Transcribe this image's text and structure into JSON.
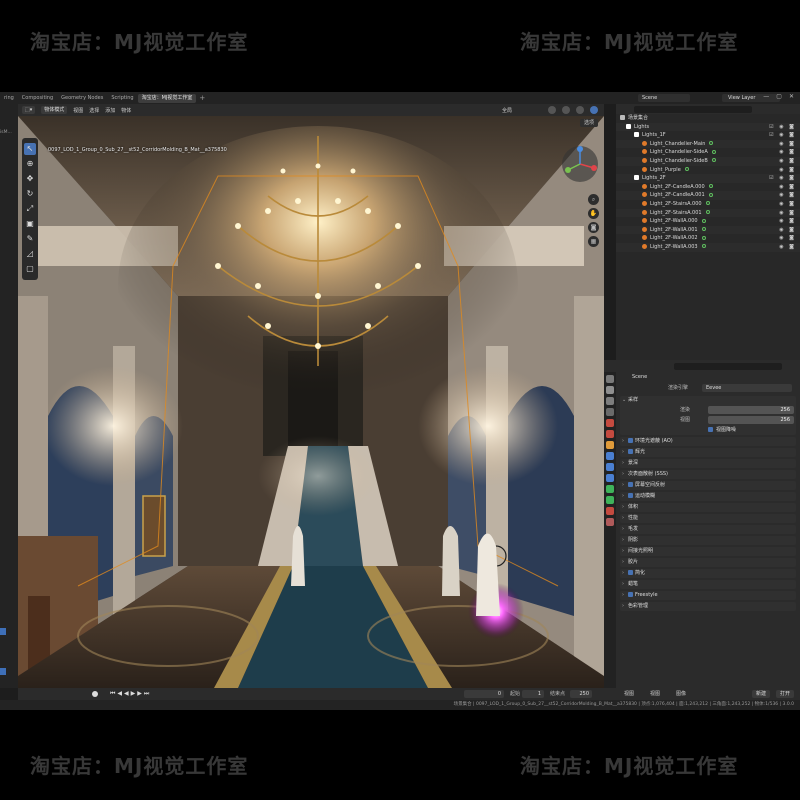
{
  "watermark": "淘宝店：MJ视觉工作室",
  "topbar": {
    "tabs": [
      "ring",
      "Compositing",
      "Geometry Nodes",
      "Scripting",
      "淘宝店：MJ视觉工作室"
    ],
    "plus": "+",
    "scene": "Scene",
    "view_layer": "View Layer"
  },
  "left_strip_label": "isM...",
  "viewport": {
    "mode": "物体模式",
    "menus": [
      "视图",
      "选择",
      "添加",
      "物体"
    ],
    "transform": "全局",
    "options": "选项",
    "object_info": "0097_LOD_1_Group_0_Sub_27__st52_CorridorMolding_B_Mat__a375830"
  },
  "timeline": {
    "current": "0",
    "start_label": "起始",
    "start": "1",
    "end_label": "结束点",
    "end": "250"
  },
  "status_bar": "场景集合 | 0097_LOD_1_Group_0_Sub_27__st52_CorridorMolding_B_Mat__a375830 | 顶点:1,076,404 | 面:1,243,212 | 三角面:1,243,252 | 物体:1/536 | 3.0.0",
  "outliner": {
    "rows": [
      {
        "name": "场景集合",
        "type": "scene",
        "indent": 4
      },
      {
        "name": "Lights",
        "type": "coll",
        "indent": 10
      },
      {
        "name": "Lights_1F",
        "type": "coll",
        "indent": 18
      },
      {
        "name": "Light_Chandelier-Main",
        "type": "light",
        "indent": 26
      },
      {
        "name": "Light_Chandelier-SideA",
        "type": "light",
        "indent": 26
      },
      {
        "name": "Light_Chandelier-SideB",
        "type": "light",
        "indent": 26
      },
      {
        "name": "Light_Purple",
        "type": "light",
        "indent": 26
      },
      {
        "name": "Lights_2F",
        "type": "coll",
        "indent": 18
      },
      {
        "name": "Light_2F-CandleA.000",
        "type": "light",
        "indent": 26
      },
      {
        "name": "Light_2F-CandleA.001",
        "type": "light",
        "indent": 26
      },
      {
        "name": "Light_2F-StairsA.000",
        "type": "light",
        "indent": 26
      },
      {
        "name": "Light_2F-StairsA.001",
        "type": "light",
        "indent": 26
      },
      {
        "name": "Light_2F-WallA.000",
        "type": "light",
        "indent": 26
      },
      {
        "name": "Light_2F-WallA.001",
        "type": "light",
        "indent": 26
      },
      {
        "name": "Light_2F-WallA.002",
        "type": "light",
        "indent": 26
      },
      {
        "name": "Light_2F-WallA.003",
        "type": "light",
        "indent": 26
      }
    ]
  },
  "properties": {
    "scene_name": "Scene",
    "engine_label": "渲染引擎",
    "engine": "Eevee",
    "sampling": {
      "title": "采样",
      "render_label": "渲染",
      "render": "256",
      "viewport_label": "视图",
      "viewport": "256",
      "denoise_label": "视图降噪"
    },
    "panels": [
      {
        "label": "环境光遮蔽 (AO)",
        "checkbox": true
      },
      {
        "label": "辉光",
        "checkbox": true
      },
      {
        "label": "景深",
        "checkbox": false
      },
      {
        "label": "次表面散射 (SSS)",
        "checkbox": false
      },
      {
        "label": "屏幕空间反射",
        "checkbox": true
      },
      {
        "label": "运动模糊",
        "checkbox": true
      },
      {
        "label": "体积",
        "checkbox": false
      },
      {
        "label": "性能",
        "checkbox": false
      },
      {
        "label": "毛发",
        "checkbox": false
      },
      {
        "label": "阴影",
        "checkbox": false
      },
      {
        "label": "间接光照明",
        "checkbox": false
      },
      {
        "label": "胶片",
        "checkbox": false
      },
      {
        "label": "简化",
        "checkbox": true
      },
      {
        "label": "蜡笔",
        "checkbox": false
      },
      {
        "label": "Freestyle",
        "checkbox": true
      },
      {
        "label": "色彩管理",
        "checkbox": false
      }
    ]
  },
  "right_bottom": {
    "menus": [
      "视图",
      "视图",
      "图像"
    ],
    "new": "新建",
    "open": "打开"
  }
}
